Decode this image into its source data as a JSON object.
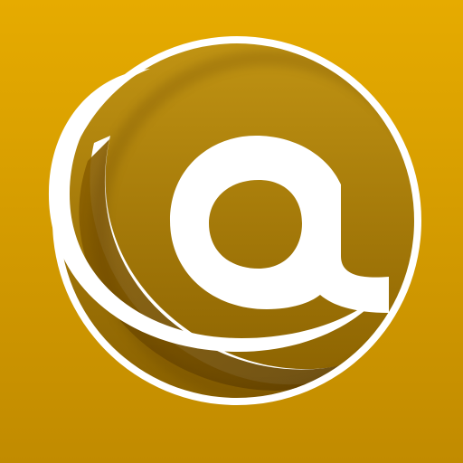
{
  "icon": {
    "name": "email-at-icon",
    "colors": {
      "background_top": "#e2a800",
      "background_bottom": "#b98500",
      "disc_light": "#c59310",
      "disc_dark": "#7a5200",
      "glyph": "#ffffff",
      "inner_shadow": "#5b3d00"
    }
  }
}
